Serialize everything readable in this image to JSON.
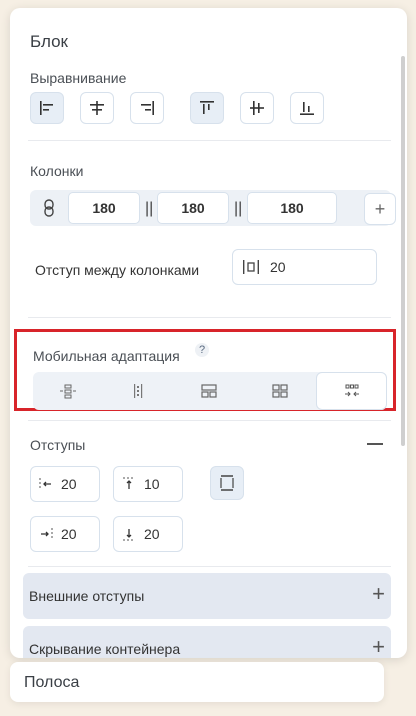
{
  "block": {
    "title": "Блок"
  },
  "alignment": {
    "label": "Выравнивание",
    "buttons": [
      {
        "icon": "align-left-icon",
        "active": true
      },
      {
        "icon": "align-center-horizontal-icon",
        "active": false
      },
      {
        "icon": "align-right-icon",
        "active": false
      },
      {
        "icon": "align-top-icon",
        "active": true
      },
      {
        "icon": "align-center-vertical-icon",
        "active": false
      },
      {
        "icon": "align-bottom-icon",
        "active": false
      }
    ]
  },
  "columns": {
    "label": "Колонки",
    "values": [
      "180",
      "180",
      "180"
    ],
    "separator": "||",
    "add_symbol": "+",
    "gap_label": "Отступ между колонками",
    "gap_value": "20"
  },
  "mobile": {
    "label": "Мобильная адаптация",
    "help": "?",
    "options": [
      {
        "icon": "stack-vertical-icon"
      },
      {
        "icon": "column-split-icon"
      },
      {
        "icon": "grid-1-2-icon"
      },
      {
        "icon": "grid-2-2-icon"
      },
      {
        "icon": "compress-horizontal-icon",
        "active": true
      }
    ]
  },
  "paddings": {
    "label": "Отступы",
    "left": "20",
    "top": "10",
    "right": "20",
    "bottom": "20"
  },
  "accordions": [
    {
      "label": "Внешние отступы"
    },
    {
      "label": "Скрывание контейнера"
    }
  ],
  "next_block": {
    "title": "Полоса"
  },
  "colors": {
    "accent": "#d8242a",
    "active_bg": "#e7eef6",
    "border": "#d7e1ec"
  }
}
